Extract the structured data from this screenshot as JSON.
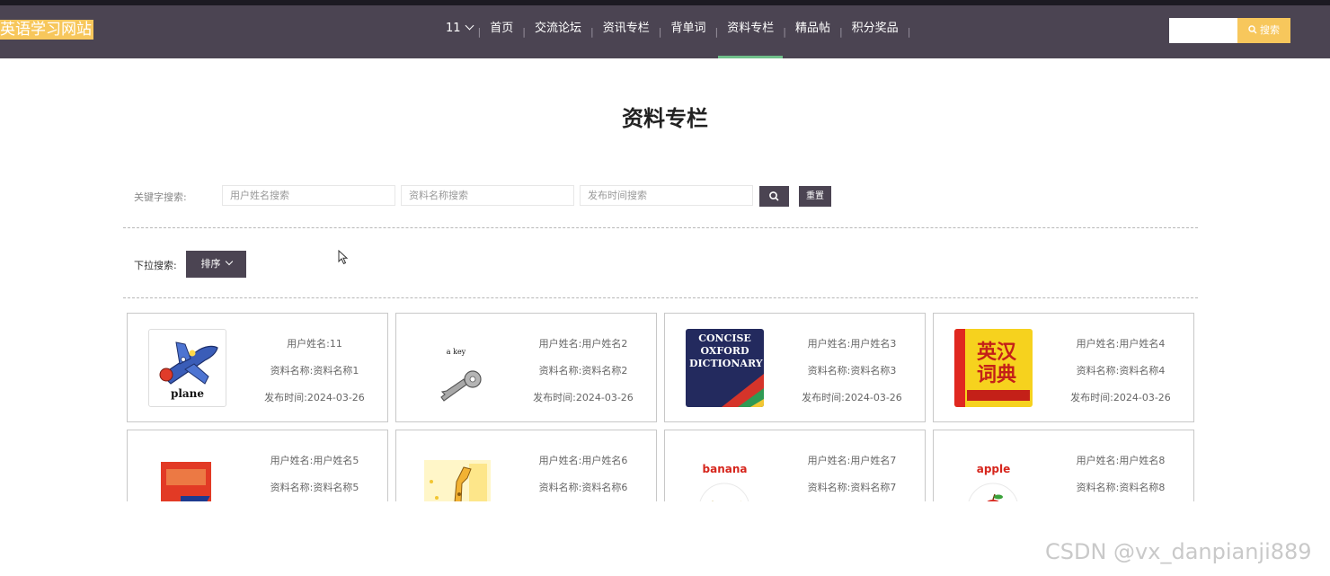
{
  "site": {
    "logo_text": "英语学习网站",
    "brand_color": "#4b4452",
    "accent_color": "#f7c75c",
    "active_underline_color": "#6fbf8a"
  },
  "nav": {
    "user": "11",
    "items": [
      "首页",
      "交流论坛",
      "资讯专栏",
      "背单词",
      "资料专栏",
      "精品帖",
      "积分奖品"
    ],
    "active": "资料专栏"
  },
  "top_search": {
    "placeholder": "",
    "button_label": "搜索",
    "button_icon": "search-icon"
  },
  "page": {
    "title": "资料专栏"
  },
  "filters": {
    "keyword_label": "关键字搜索:",
    "user_placeholder": "用户姓名搜索",
    "name_placeholder": "资料名称搜索",
    "date_placeholder": "发布时间搜索",
    "search_icon": "search-icon",
    "reset_label": "重置",
    "dropdown_label": "下拉搜索:",
    "sort_label": "排序"
  },
  "cards": [
    {
      "user": "用户姓名:11",
      "name": "资料名称:资料名称1",
      "date": "发布时间:2024-03-26",
      "image": "plane",
      "image_text": "plane"
    },
    {
      "user": "用户姓名:用户姓名2",
      "name": "资料名称:资料名称2",
      "date": "发布时间:2024-03-26",
      "image": "key",
      "image_text": "a key"
    },
    {
      "user": "用户姓名:用户姓名3",
      "name": "资料名称:资料名称3",
      "date": "发布时间:2024-03-26",
      "image": "oxford-dictionary",
      "image_text": "CONCISE OXFORD DICTIONARY"
    },
    {
      "user": "用户姓名:用户姓名4",
      "name": "资料名称:资料名称4",
      "date": "发布时间:2024-03-26",
      "image": "chinese-dictionary",
      "image_text": "英汉词典"
    },
    {
      "user": "用户姓名:用户姓名5",
      "name": "资料名称:资料名称5",
      "date": "",
      "image": "red-book",
      "image_text": ""
    },
    {
      "user": "用户姓名:用户姓名6",
      "name": "资料名称:资料名称6",
      "date": "",
      "image": "giraffe",
      "image_text": ""
    },
    {
      "user": "用户姓名:用户姓名7",
      "name": "资料名称:资料名称7",
      "date": "",
      "image": "banana",
      "image_text": "banana"
    },
    {
      "user": "用户姓名:用户姓名8",
      "name": "资料名称:资料名称8",
      "date": "",
      "image": "apple",
      "image_text": "apple"
    }
  ],
  "watermark": "CSDN @vx_danpianji889"
}
